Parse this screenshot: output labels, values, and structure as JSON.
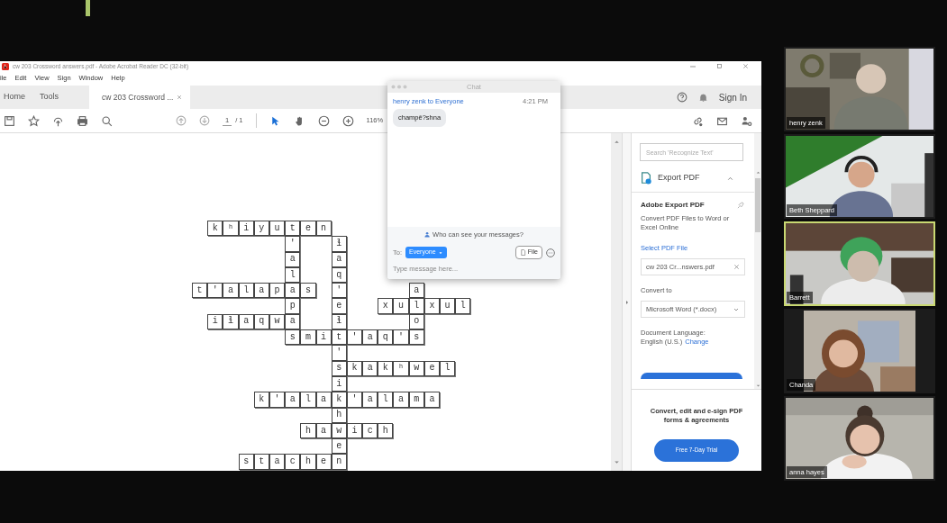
{
  "acrobat": {
    "title": "cw 203 Crossword answers.pdf - Adobe Acrobat Reader DC (32-bit)",
    "menu": [
      "ile",
      "Edit",
      "View",
      "Sign",
      "Window",
      "Help"
    ],
    "tabs": [
      {
        "label": "Home",
        "selected": false
      },
      {
        "label": "Tools",
        "selected": false
      },
      {
        "label": "cw 203 Crossword ...",
        "selected": true
      }
    ],
    "sign_in": "Sign In",
    "toolbar": {
      "page": "1",
      "page_total": "/ 1",
      "zoom": "116%",
      "tools": [
        {
          "kind": "select",
          "selected": true
        },
        {
          "kind": "hand",
          "selected": false
        }
      ]
    },
    "crossword": {
      "rows": [
        [
          null,
          "k",
          "ʰ",
          "i",
          "y",
          "u",
          "t",
          "e",
          "n",
          null,
          null,
          null,
          null,
          null,
          null,
          null,
          null,
          null
        ],
        [
          null,
          null,
          null,
          null,
          null,
          null,
          "'",
          null,
          null,
          "ɬ",
          null,
          null,
          null,
          null,
          null,
          null,
          null,
          null
        ],
        [
          null,
          null,
          null,
          null,
          null,
          null,
          "a",
          null,
          null,
          "a",
          null,
          null,
          null,
          null,
          null,
          null,
          null,
          null
        ],
        [
          null,
          null,
          null,
          null,
          null,
          null,
          "l",
          null,
          null,
          "q",
          null,
          null,
          null,
          null,
          null,
          null,
          null,
          null
        ],
        [
          "t",
          "'",
          "a",
          "l",
          "a",
          "p",
          "a",
          "s",
          null,
          "'",
          null,
          null,
          null,
          null,
          "a",
          null,
          null,
          null
        ],
        [
          null,
          null,
          null,
          null,
          null,
          null,
          "p",
          null,
          null,
          "e",
          null,
          null,
          "x",
          "u",
          "l",
          "x",
          "u",
          "l"
        ],
        [
          null,
          "i",
          "ɬ",
          "a",
          "q",
          "w",
          "a",
          null,
          null,
          "ɬ",
          null,
          null,
          null,
          null,
          "o",
          null,
          null,
          null
        ],
        [
          null,
          null,
          null,
          null,
          null,
          null,
          "s",
          "m",
          "i",
          "t",
          "'",
          "a",
          "q",
          "'",
          "s",
          null,
          null,
          null
        ],
        [
          null,
          null,
          null,
          null,
          null,
          null,
          null,
          null,
          null,
          "'",
          null,
          null,
          null,
          null,
          null,
          null,
          null,
          null
        ],
        [
          null,
          null,
          null,
          null,
          null,
          null,
          null,
          null,
          null,
          "s",
          "k",
          "a",
          "k",
          "ʰ",
          "w",
          "e",
          "l",
          null
        ],
        [
          null,
          null,
          null,
          null,
          null,
          null,
          null,
          null,
          null,
          "i",
          null,
          null,
          null,
          null,
          null,
          null,
          null,
          null
        ],
        [
          null,
          null,
          null,
          null,
          "k",
          "'",
          "a",
          "l",
          "a",
          "k",
          "'",
          "a",
          "l",
          "a",
          "m",
          "a",
          null,
          null
        ],
        [
          null,
          null,
          null,
          null,
          null,
          null,
          null,
          null,
          null,
          "h",
          null,
          null,
          null,
          null,
          null,
          null,
          null,
          null
        ],
        [
          null,
          null,
          null,
          null,
          null,
          null,
          null,
          "h",
          "a",
          "w",
          "i",
          "c",
          "h",
          null,
          null,
          null,
          null,
          null
        ],
        [
          null,
          null,
          null,
          null,
          null,
          null,
          null,
          null,
          null,
          "e",
          null,
          null,
          null,
          null,
          null,
          null,
          null,
          null
        ],
        [
          null,
          null,
          null,
          "s",
          "t",
          "a",
          "c",
          "h",
          "e",
          "n",
          null,
          null,
          null,
          null,
          null,
          null,
          null,
          null
        ]
      ]
    },
    "panel": {
      "search_placeholder": "Search 'Recognize Text'",
      "tool": "Export PDF",
      "heading": "Adobe Export PDF",
      "description": "Convert PDF Files to Word or Excel Online",
      "select_label": "Select PDF File",
      "file": "cw 203 Cr...nswers.pdf",
      "convert_label": "Convert to",
      "format": "Microsoft Word (*.docx)",
      "language_label": "Document Language:",
      "language": "English (U.S.)",
      "change_link": "Change",
      "promo": "Convert, edit and e-sign PDF forms & agreements",
      "trial_button": "Free 7-Day Trial"
    }
  },
  "chat": {
    "title": "Chat",
    "messages": [
      {
        "header": "henry zenk to Everyone",
        "time": "4:21 PM",
        "text": "champê?shna"
      }
    ],
    "privacy": "Who can see your messages?",
    "to_label": "To:",
    "recipient": "Everyone",
    "file_button": "File",
    "placeholder": "Type message here..."
  },
  "participants": [
    {
      "name": "henry zenk",
      "speaking": false
    },
    {
      "name": "Beth Sheppard",
      "speaking": false
    },
    {
      "name": "Barrett",
      "speaking": true
    },
    {
      "name": "Chanda",
      "speaking": false
    },
    {
      "name": "anna hayes",
      "speaking": false
    }
  ]
}
